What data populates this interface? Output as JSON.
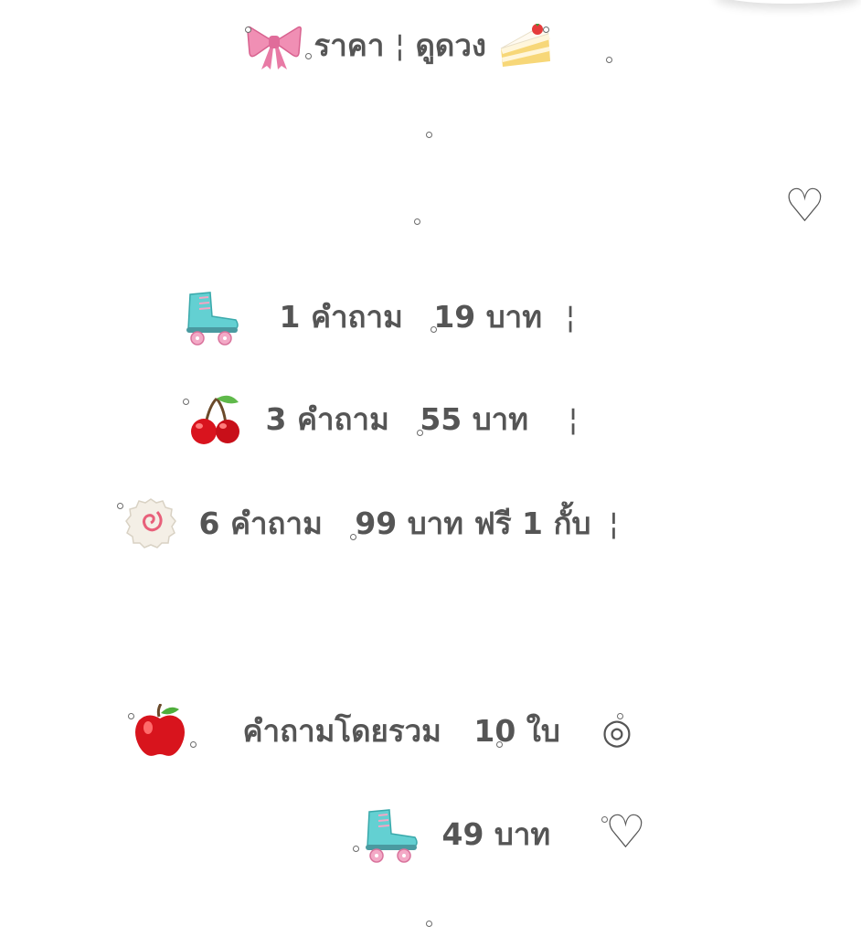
{
  "title": {
    "left": "ราคา",
    "sep": "¦",
    "right": "ดูดวง"
  },
  "prices": [
    {
      "qty": "1 คำถาม",
      "price": "19 บาท",
      "mark": "¦"
    },
    {
      "qty": "3 คำถาม",
      "price": "55 บาท",
      "mark": "¦"
    },
    {
      "qty": "6 คำถาม",
      "price": "99 บาท ฟรี 1 กั้บ",
      "mark": "¦"
    }
  ],
  "overall": {
    "label": "คำถามโดยรวม",
    "cards": "10 ใบ",
    "price": "49 บาท"
  },
  "symbols": {
    "heart": "♡",
    "spiral": "◎"
  },
  "icons": [
    "ribbon-icon",
    "cake-icon",
    "roller-skate-icon",
    "cherry-icon",
    "fish-cake-icon",
    "apple-icon",
    "spiral-icon",
    "heart-icon"
  ]
}
